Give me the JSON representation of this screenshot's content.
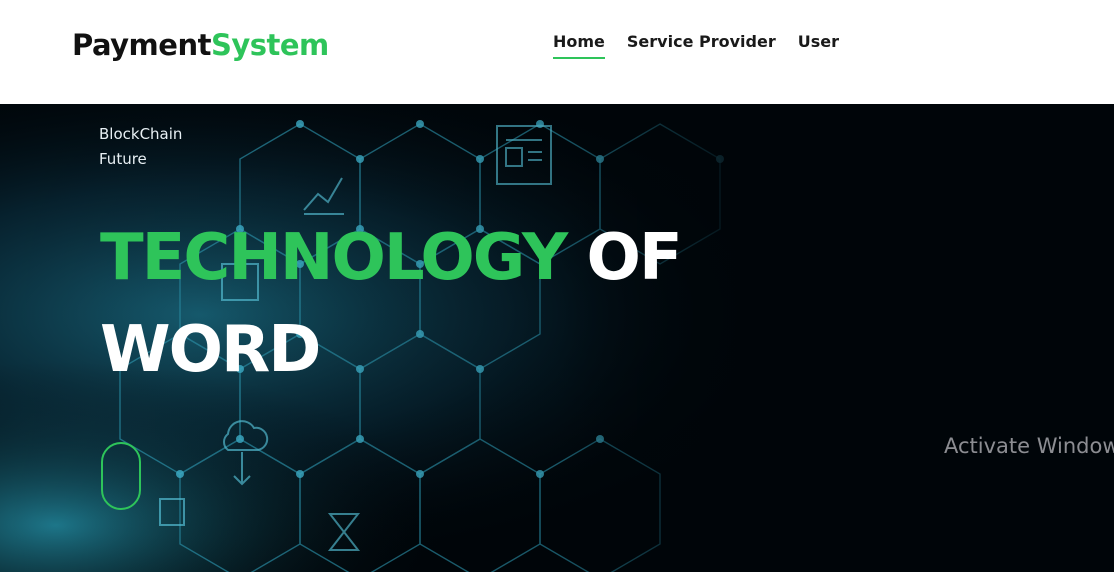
{
  "header": {
    "brand_part1": "Payment",
    "brand_part2": "System",
    "nav": [
      {
        "label": "Home",
        "active": true
      },
      {
        "label": "Service Provider",
        "active": false
      },
      {
        "label": "User",
        "active": false
      }
    ]
  },
  "hero": {
    "tagline_line1": "BlockChain",
    "tagline_line2": "Future",
    "headline_green": "TECHNOLOGY",
    "headline_white1": "OF",
    "headline_white2": "WORD"
  },
  "watermark": "Activate Windows",
  "colors": {
    "accent": "#2ec45a",
    "hero_bg": "#000509",
    "network": "#2a8ea6"
  }
}
